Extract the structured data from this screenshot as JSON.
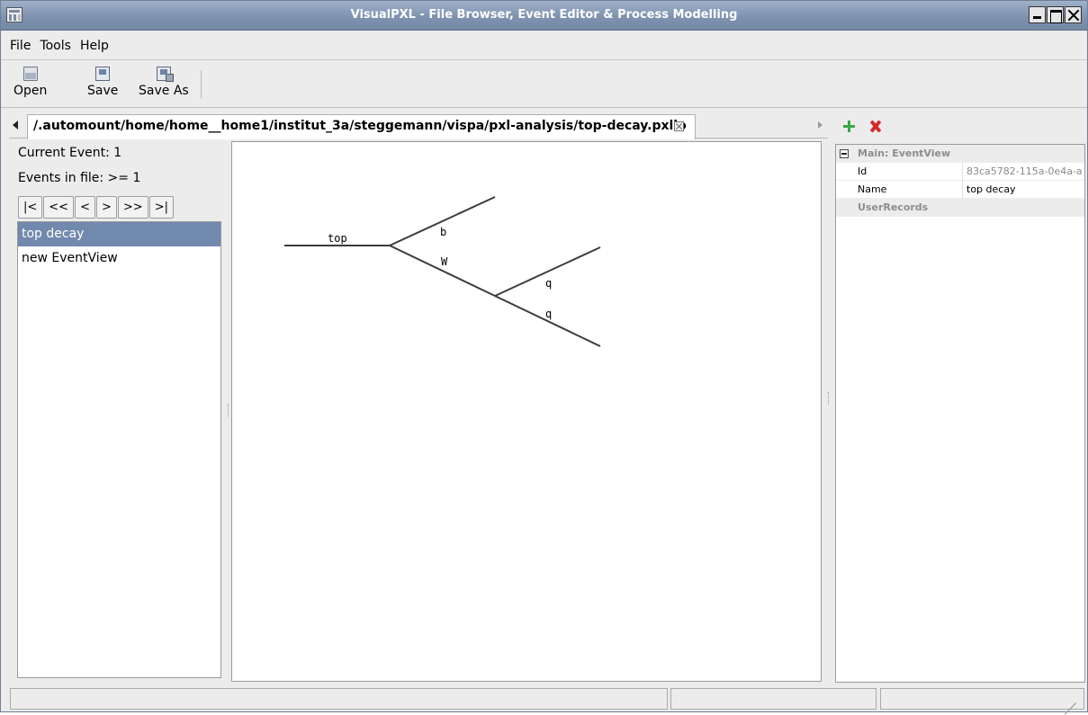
{
  "window": {
    "title": "VisualPXL - File Browser, Event Editor & Process Modelling"
  },
  "menu": [
    "File",
    "Tools",
    "Help"
  ],
  "toolbar": {
    "open": "Open",
    "save": "Save",
    "save_as": "Save As"
  },
  "tab": {
    "path": "/.automount/home/home__home1/institut_3a/steggemann/vispa/pxl-analysis/top-decay.pxlio"
  },
  "event_info": {
    "current": "Current Event:  1",
    "in_file": "Events in file:   >= 1"
  },
  "nav_buttons": [
    "|<",
    "<<",
    "<",
    ">",
    ">>",
    ">|"
  ],
  "event_list": [
    "top decay",
    "new EventView"
  ],
  "diagram": {
    "labels": {
      "top": "top",
      "b": "b",
      "w": "W",
      "q1": "q",
      "q2": "q"
    }
  },
  "properties": {
    "group_main": "Main: EventView",
    "rows": [
      {
        "key": "Id",
        "value": "83ca5782-115a-0e4a-a"
      },
      {
        "key": "Name",
        "value": "top decay"
      }
    ],
    "group_user": "UserRecords"
  }
}
